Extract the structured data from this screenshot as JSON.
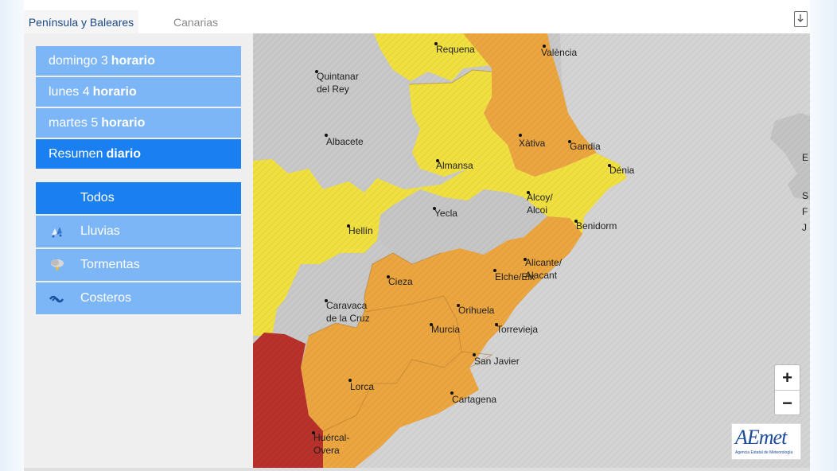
{
  "tabs": [
    {
      "label": "Península y Baleares",
      "active": true
    },
    {
      "label": "Canarias",
      "active": false
    }
  ],
  "days": [
    {
      "prefix": "domingo 3",
      "kind": "horario",
      "active": false
    },
    {
      "prefix": "lunes 4",
      "kind": "horario",
      "active": false
    },
    {
      "prefix": "martes 5",
      "kind": "horario",
      "active": false
    },
    {
      "prefix": "Resumen",
      "kind": "diario",
      "active": true
    }
  ],
  "phenomena": [
    {
      "label": "Todos",
      "icon": "none",
      "active": true
    },
    {
      "label": "Lluvias",
      "icon": "rain-icon",
      "active": false
    },
    {
      "label": "Tormentas",
      "icon": "storm-icon",
      "active": false
    },
    {
      "label": "Costeros",
      "icon": "coastal-wave-icon",
      "active": false
    }
  ],
  "map": {
    "warning_colors": {
      "none": "#c9c9c9",
      "yellow": "#f0e040",
      "orange": "#eca640",
      "red": "#b8312b"
    },
    "towns": [
      {
        "name": "Requena"
      },
      {
        "name": "València"
      },
      {
        "name": "Quintanar\ndel Rey"
      },
      {
        "name": "Albacete"
      },
      {
        "name": "Xàtiva"
      },
      {
        "name": "Gandia"
      },
      {
        "name": "Almansa"
      },
      {
        "name": "Dénia"
      },
      {
        "name": "Alcoy/\nAlcoi"
      },
      {
        "name": "Yecla"
      },
      {
        "name": "Benidorm"
      },
      {
        "name": "Hellín"
      },
      {
        "name": "Alicante/\nAlacant"
      },
      {
        "name": "Cieza"
      },
      {
        "name": "Elche/Elx"
      },
      {
        "name": "Caravaca\nde la Cruz"
      },
      {
        "name": "Orihuela"
      },
      {
        "name": "Murcia"
      },
      {
        "name": "Torrevieja"
      },
      {
        "name": "San Javier"
      },
      {
        "name": "Lorca"
      },
      {
        "name": "Cartagena"
      },
      {
        "name": "Huércal-\nOvera"
      }
    ],
    "island_fragments": [
      "E",
      "S",
      "F",
      "J"
    ]
  },
  "zoom": {
    "in_label": "+",
    "out_label": "−"
  },
  "logo": {
    "text": "AEmet",
    "subtext": "Agencia Estatal de Meteorología"
  }
}
